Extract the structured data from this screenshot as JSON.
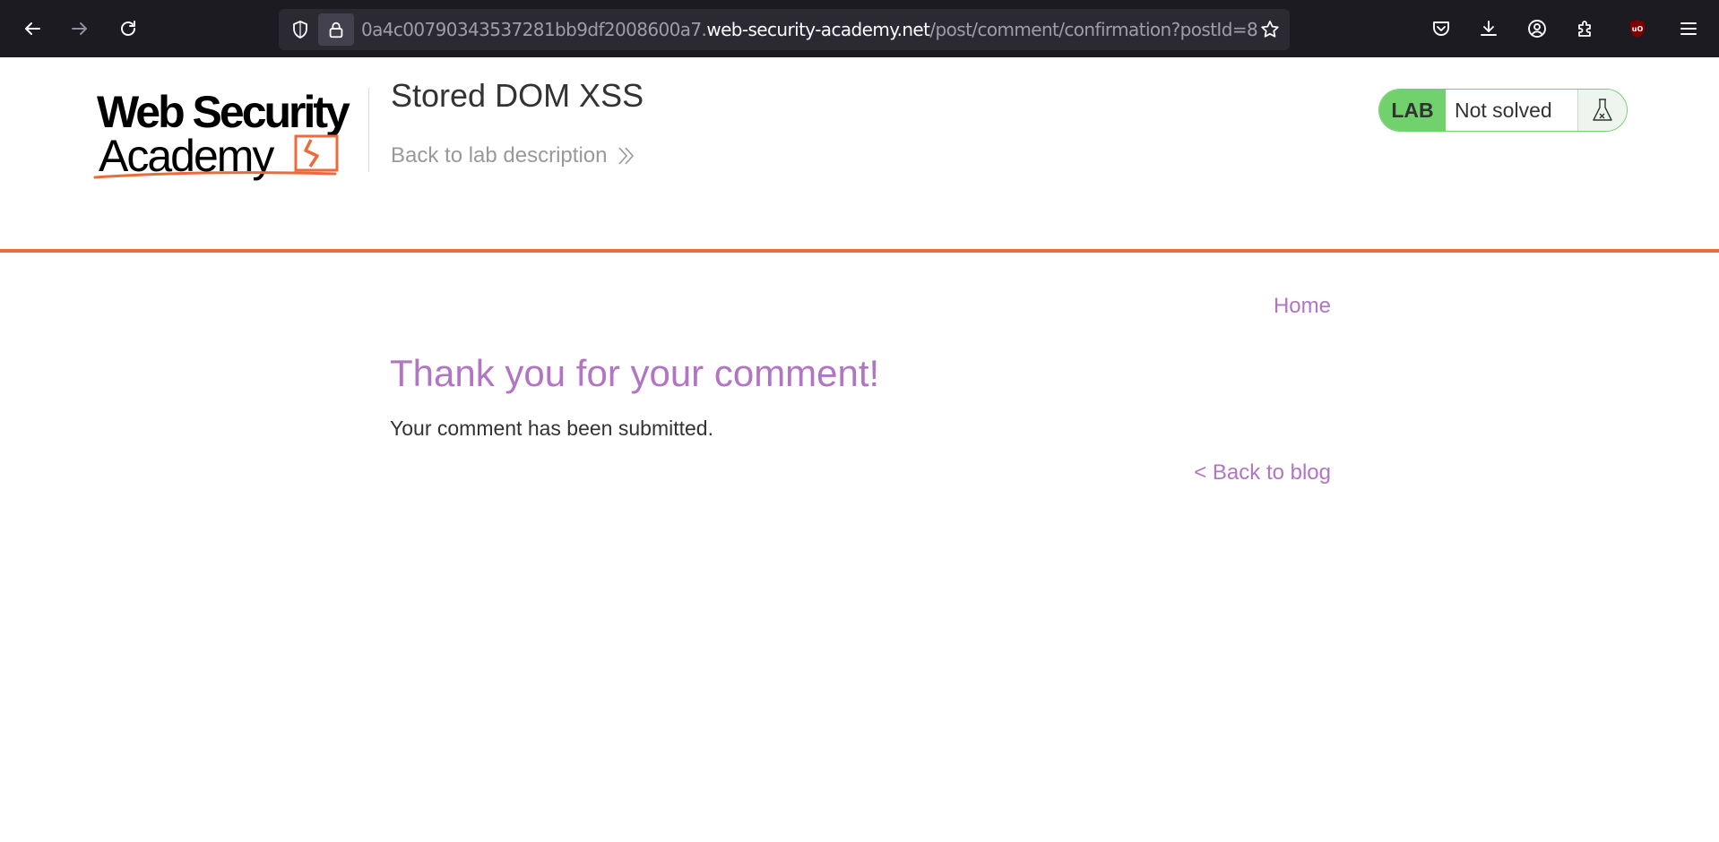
{
  "browser": {
    "url_prefix": "0a4c00790343537281bb9df2008600a7.",
    "url_host": "web-security-academy.net",
    "url_path": "/post/comment/confirmation?postId=8",
    "icons": {
      "back": "back-arrow-icon",
      "forward": "forward-arrow-icon",
      "reload": "reload-icon",
      "tracking": "shield-icon",
      "lock": "lock-icon",
      "bookmark": "star-icon",
      "pocket": "pocket-icon",
      "downloads": "download-icon",
      "account": "account-icon",
      "extensions": "puzzle-icon",
      "ublock": "ublock-icon",
      "menu": "hamburger-menu-icon"
    }
  },
  "header": {
    "logo_line1": "Web Security",
    "logo_line2": "Academy",
    "lab_title": "Stored DOM XSS",
    "back_to_lab": "Back to lab description",
    "status_tag": "LAB",
    "status_text": "Not solved"
  },
  "main": {
    "home_link": "Home",
    "heading": "Thank you for your comment!",
    "message": "Your comment has been submitted.",
    "back_to_blog": "< Back to blog"
  },
  "colors": {
    "toolbar_bg": "#1c1b22",
    "urlbar_bg": "#2b2a33",
    "accent_orange": "#ec6b3c",
    "link_purple": "#b275c4",
    "lab_green": "#70d16d",
    "text_dark": "#333332"
  }
}
